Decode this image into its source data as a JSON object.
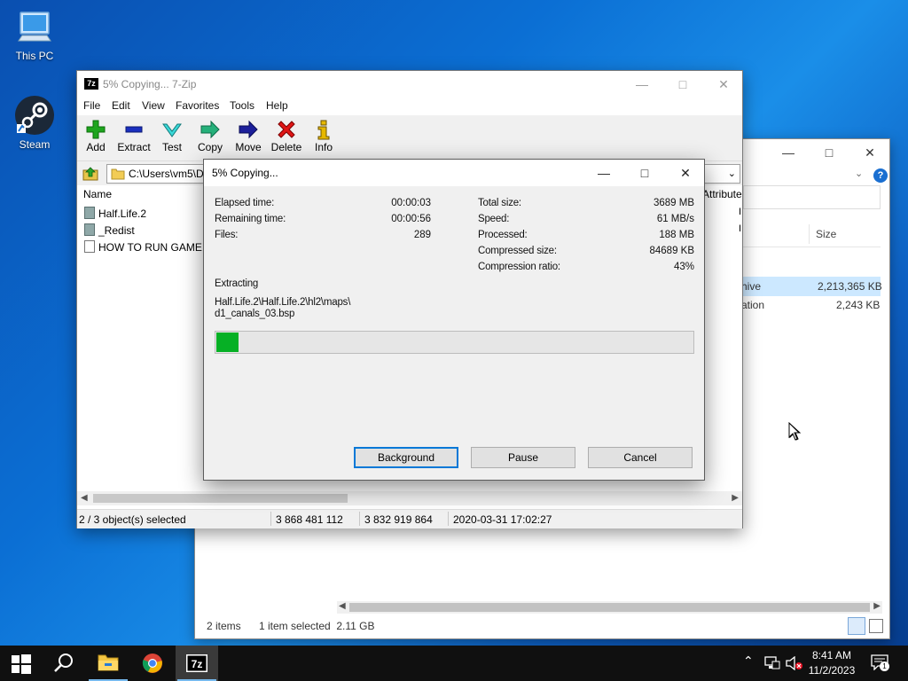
{
  "desktop": {
    "icons": [
      {
        "label": "This PC"
      },
      {
        "label": "Steam"
      }
    ]
  },
  "explorer": {
    "size_header": "Size",
    "rows": [
      {
        "name_partial": "hive",
        "size": "2,213,365 KB"
      },
      {
        "name_partial": "ation",
        "size": "2,243 KB"
      }
    ],
    "status_items": "2 items",
    "status_selected": "1 item selected  2.11 GB"
  },
  "zip": {
    "title": "5% Copying... 7-Zip",
    "logo_text": "7z",
    "menu": [
      "File",
      "Edit",
      "View",
      "Favorites",
      "Tools",
      "Help"
    ],
    "toolbar": [
      "Add",
      "Extract",
      "Test",
      "Copy",
      "Move",
      "Delete",
      "Info"
    ],
    "address": "C:\\Users\\vm5\\De",
    "columns": {
      "name": "Name",
      "attributes": "Attribute"
    },
    "files": [
      {
        "name": "Half.Life.2",
        "kind": "folder"
      },
      {
        "name": "_Redist",
        "kind": "folder"
      },
      {
        "name": "HOW TO RUN GAME!!.t",
        "kind": "file"
      }
    ],
    "status": {
      "selection": "2 / 3 object(s) selected",
      "size": "3 868 481 112",
      "packed": "3 832 919 864",
      "modified": "2020-03-31 17:02:27"
    }
  },
  "dialog": {
    "title": "5% Copying...",
    "left": [
      {
        "label": "Elapsed time:",
        "value": "00:00:03"
      },
      {
        "label": "Remaining time:",
        "value": "00:00:56"
      },
      {
        "label": "Files:",
        "value": "289"
      }
    ],
    "right": [
      {
        "label": "Total size:",
        "value": "3689 MB"
      },
      {
        "label": "Speed:",
        "value": "61 MB/s"
      },
      {
        "label": "Processed:",
        "value": "188 MB"
      },
      {
        "label": "Compressed size:",
        "value": "84689 KB"
      },
      {
        "label": "Compression ratio:",
        "value": "43%"
      }
    ],
    "operation": "Extracting",
    "path_line1": "Half.Life.2\\Half.Life.2\\hl2\\maps\\",
    "path_line2": "d1_canals_03.bsp",
    "progress_percent": 5,
    "buttons": {
      "background": "Background",
      "pause": "Pause",
      "cancel": "Cancel"
    }
  },
  "taskbar": {
    "time": "8:41 AM",
    "date": "11/2/2023",
    "notification_count": "1"
  },
  "colors": {
    "progress_fill": "#06b025",
    "accent": "#0078d7",
    "taskbar": "#101010"
  }
}
